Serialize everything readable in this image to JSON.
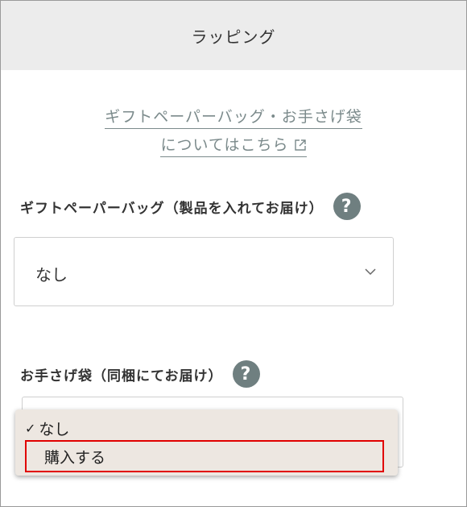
{
  "header": {
    "title": "ラッピング"
  },
  "info_link": {
    "line1": "ギフトペーパーバッグ・お手さげ袋",
    "line2": "についてはこちら",
    "icon": "external-link-icon"
  },
  "gift_bag": {
    "label": "ギフトペーパーバッグ（製品を入れてお届け）",
    "help": "?",
    "selected": "なし"
  },
  "hand_bag": {
    "label": "お手さげ袋（同梱にてお届け）",
    "help": "?",
    "options": [
      {
        "label": "なし",
        "selected": true,
        "check": "✓"
      },
      {
        "label": "購入する",
        "selected": false
      }
    ]
  },
  "colors": {
    "header_bg": "#ececec",
    "link": "#7b8a8b",
    "help_icon_bg": "#6f7f80",
    "dropdown_bg": "#ede7e1",
    "highlight_border": "#e10000"
  }
}
